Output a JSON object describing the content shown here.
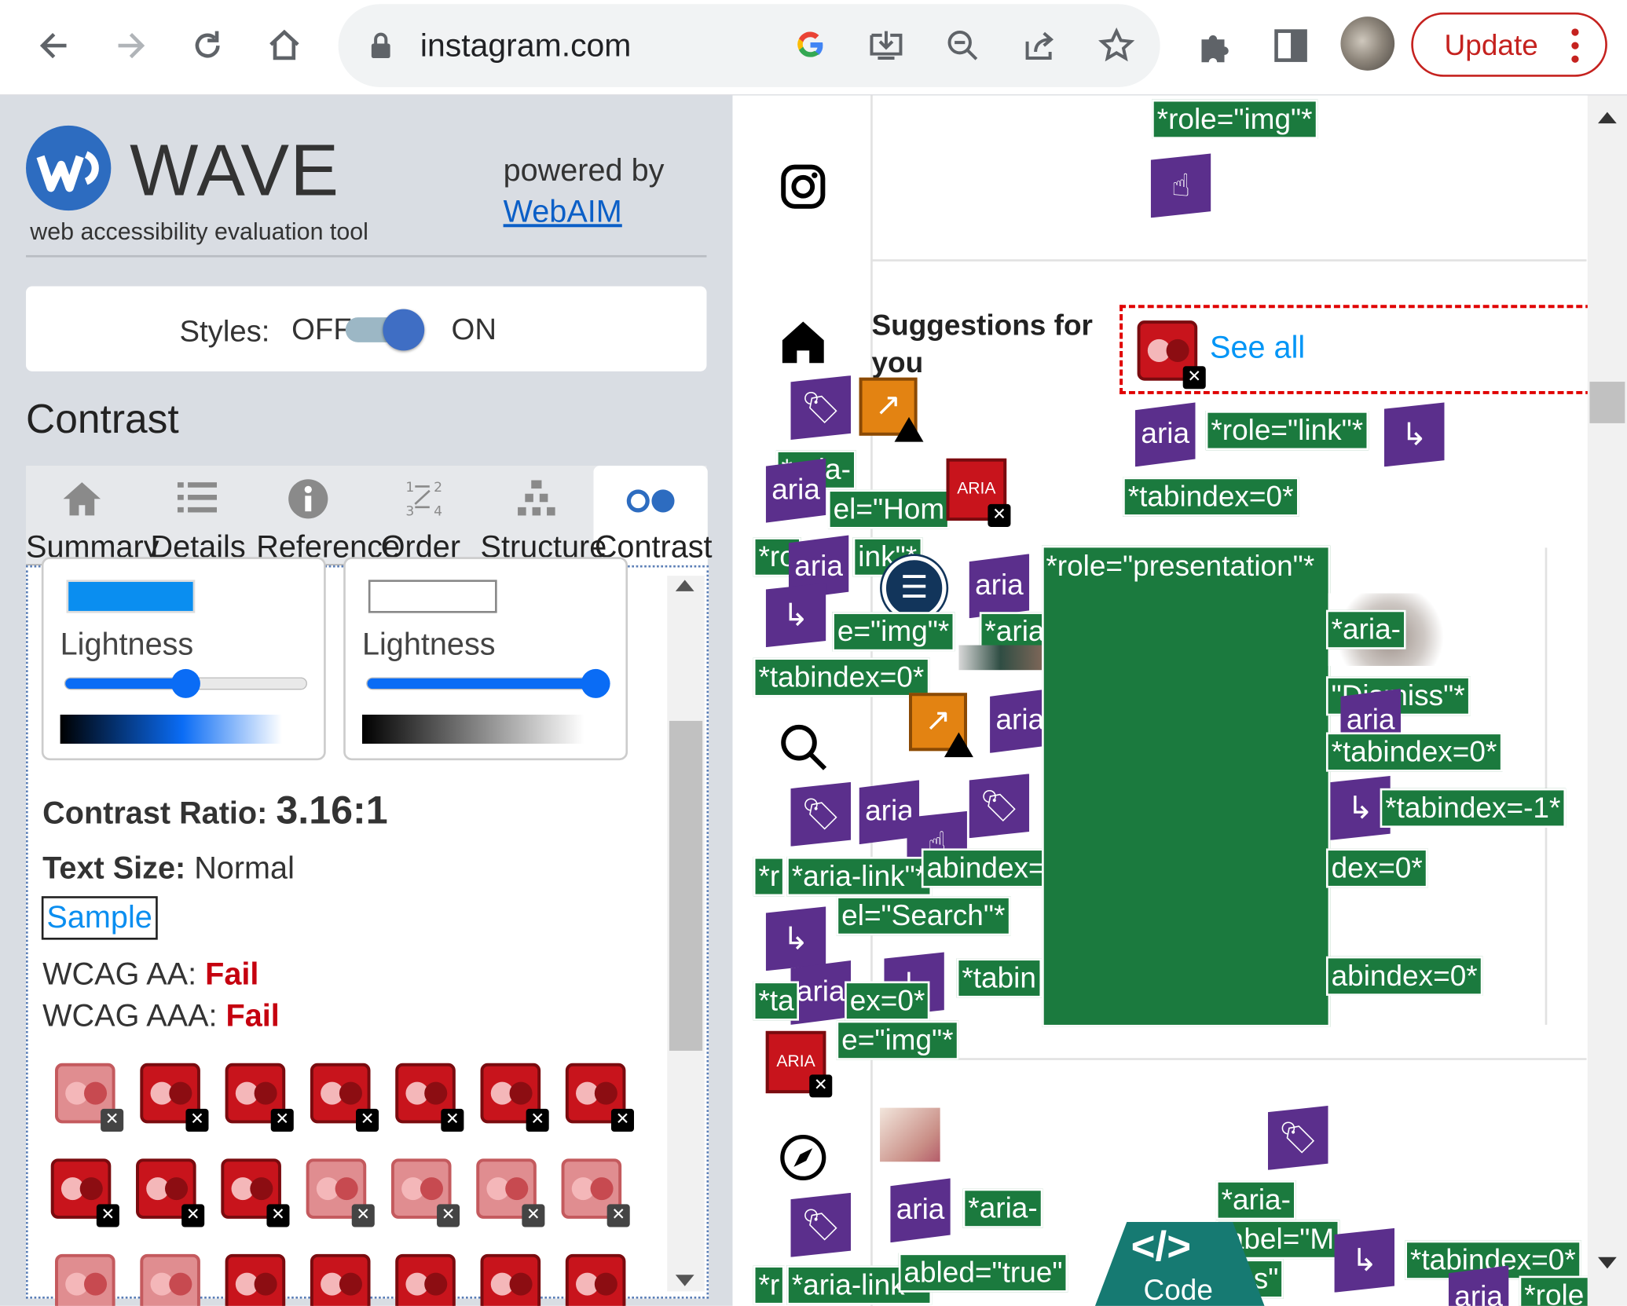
{
  "browser": {
    "url": "instagram.com",
    "update_label": "Update"
  },
  "wave": {
    "title": "WAVE",
    "subtitle": "web accessibility evaluation tool",
    "powered_by": "powered by",
    "webaim_link": "WebAIM",
    "styles_label": "Styles:",
    "styles_off": "OFF",
    "styles_on": "ON",
    "section_heading": "Contrast",
    "tabs": [
      {
        "label": "Summary",
        "icon": "home-icon"
      },
      {
        "label": "Details",
        "icon": "list-icon"
      },
      {
        "label": "Reference",
        "icon": "info-icon"
      },
      {
        "label": "Order",
        "icon": "order-icon"
      },
      {
        "label": "Structure",
        "icon": "structure-icon"
      },
      {
        "label": "Contrast",
        "icon": "contrast-icon",
        "active": true
      }
    ],
    "foreground": {
      "lightness_label": "Lightness",
      "swatch_color": "#0a8ef0",
      "lightness": 0.5
    },
    "background": {
      "lightness_label": "Lightness",
      "swatch_color": "#ffffff",
      "lightness": 0.95
    },
    "contrast_ratio_label": "Contrast Ratio:",
    "contrast_ratio_value": "3.16:1",
    "text_size_label": "Text Size:",
    "text_size_value": "Normal",
    "sample_label": "Sample",
    "wcag_aa_label": "WCAG AA:",
    "wcag_aa_value": "Fail",
    "wcag_aaa_label": "WCAG AAA:",
    "wcag_aaa_value": "Fail",
    "fail_color": "#c5000f"
  },
  "page": {
    "suggestions_heading": "Suggestions for you",
    "see_all": "See all",
    "code_label": "Code",
    "aria_badge": "aria",
    "aria_icon_text": "ARIA",
    "labels": {
      "role_img": "*role=\"img\"*",
      "role_link": "*role=\"link\"*",
      "tabindex0": "*tabindex=0*",
      "role_presentation": "*role=\"presentation\"*",
      "aria_link": "*aria-link\"*",
      "tabindex_neg1": "*tabindex=-1*",
      "label_search": "el=\"Search\"*",
      "label_home": "el=\"Hom",
      "e_img": "e=\"img\"*",
      "dismiss": "\"Dismiss\"*",
      "aria_dash": "*aria-",
      "aria_dash2": "*aria-",
      "abled": "abled=\"true\"",
      "label_m": "label=\"M",
      "ons": "ons\"",
      "tabin": "*tabin",
      "abindex0": "abindex=0*",
      "dex0": "dex=0*",
      "idex": "abindex=",
      "r": "*r",
      "role_partial": "*role",
      "ta": "*ta",
      "ex0": "ex=0*",
      "r_link": "*ro",
      "ink": "ink\"*",
      "aria_short": "*aria",
      "aria_d": "*aria-"
    }
  }
}
